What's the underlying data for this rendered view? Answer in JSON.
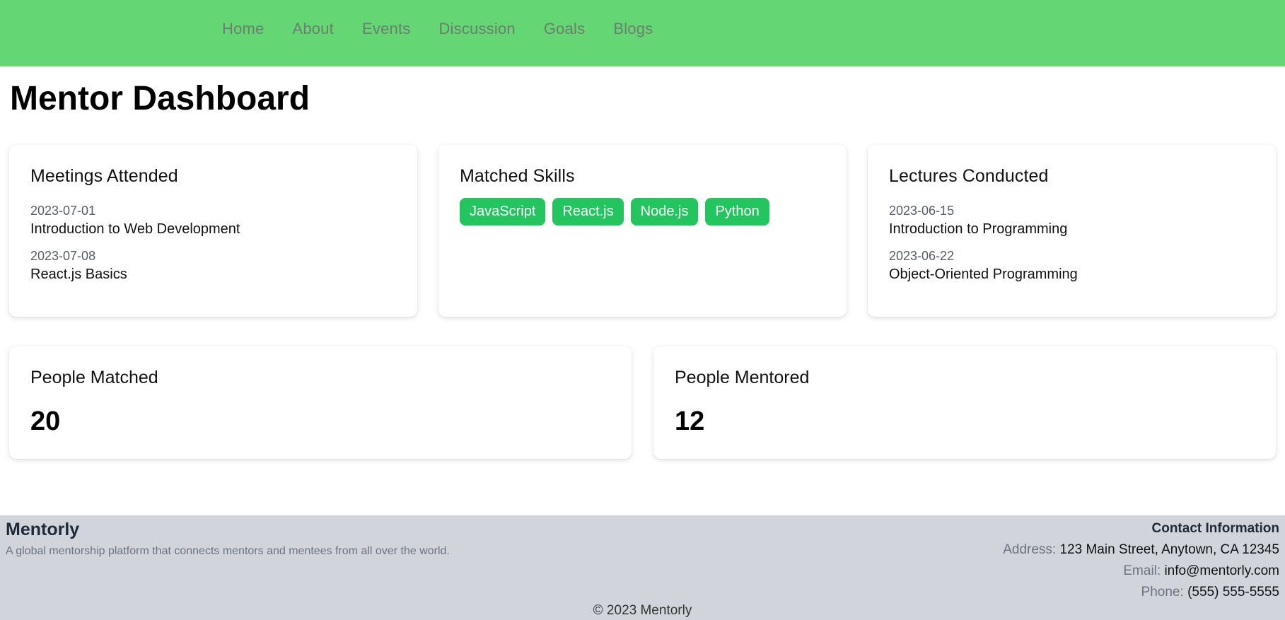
{
  "nav": {
    "items": [
      "Home",
      "About",
      "Events",
      "Discussion",
      "Goals",
      "Blogs"
    ]
  },
  "page": {
    "title": "Mentor Dashboard"
  },
  "meetings": {
    "title": "Meetings Attended",
    "entries": [
      {
        "date": "2023-07-01",
        "title": "Introduction to Web Development"
      },
      {
        "date": "2023-07-08",
        "title": "React.js Basics"
      }
    ]
  },
  "skills": {
    "title": "Matched Skills",
    "items": [
      "JavaScript",
      "React.js",
      "Node.js",
      "Python"
    ]
  },
  "lectures": {
    "title": "Lectures Conducted",
    "entries": [
      {
        "date": "2023-06-15",
        "title": "Introduction to Programming"
      },
      {
        "date": "2023-06-22",
        "title": "Object-Oriented Programming"
      }
    ]
  },
  "stats": {
    "matched": {
      "label": "People Matched",
      "value": "20"
    },
    "mentored": {
      "label": "People Mentored",
      "value": "12"
    }
  },
  "footer": {
    "brand": "Mentorly",
    "tagline": "A global mentorship platform that connects mentors and mentees from all over the world.",
    "contact_heading": "Contact Information",
    "address_label": "Address:",
    "address": "123 Main Street, Anytown, CA 12345",
    "email_label": "Email:",
    "email": "info@mentorly.com",
    "phone_label": "Phone:",
    "phone": "(555) 555-5555",
    "copyright": "© 2023 Mentorly"
  },
  "colors": {
    "nav_bg": "#64d674",
    "skill_bg": "#22c55e",
    "footer_bg": "#d1d5db"
  }
}
